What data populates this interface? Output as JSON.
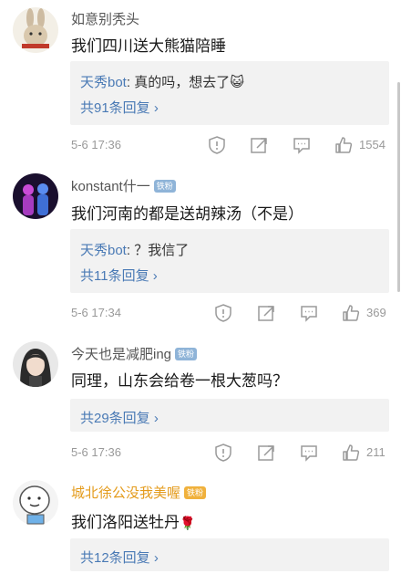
{
  "comments": [
    {
      "username": "如意别秃头",
      "text": "我们四川送大熊猫陪睡",
      "reply": {
        "user": "天秀bot",
        "text": ": 真的吗，想去了",
        "emoji": "😺"
      },
      "more": "共91条回复",
      "timestamp": "5-6 17:36",
      "likes": "1554"
    },
    {
      "username": "konstant什一",
      "badge": "铁粉",
      "text": "我们河南的都是送胡辣汤（不是）",
      "reply": {
        "user": "天秀bot",
        "text": ": ？我信了"
      },
      "more": "共11条回复",
      "timestamp": "5-6 17:34",
      "likes": "369"
    },
    {
      "username": "今天也是减肥ing",
      "badge": "铁粉",
      "text": "同理，山东会给卷一根大葱吗？",
      "more": "共29条回复",
      "timestamp": "5-6 17:36",
      "likes": "211"
    },
    {
      "username": "城北徐公没我美喔",
      "badge": "铁粉",
      "text": "我们洛阳送牡丹",
      "text_emoji": "🌹",
      "more": "共12条回复"
    }
  ],
  "colors": {
    "link": "#4a7ab5",
    "gold": "#e49b1b",
    "meta": "#999999"
  }
}
